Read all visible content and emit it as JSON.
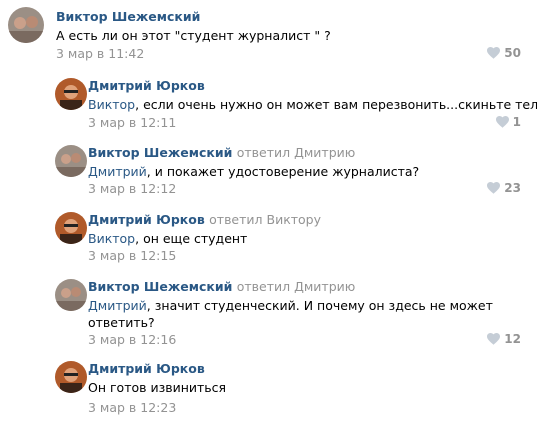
{
  "comments": [
    {
      "author": "Виктор Шежемский",
      "reply_to": "",
      "mention": "",
      "text": "А есть ли он этот \"студент журналист \" ?",
      "text2": "",
      "date": "3 мар в 11:42",
      "likes": "50",
      "avatar": "viktor"
    },
    {
      "author": "Дмитрий Юрков",
      "reply_to": "",
      "mention": "Виктор",
      "text": ", если очень нужно он может вам перезвонить...скиньте тел",
      "text2": "",
      "date": "3 мар в 12:11",
      "likes": "1",
      "avatar": "dmitry"
    },
    {
      "author": "Виктор Шежемский",
      "reply_to": "ответил Дмитрию",
      "mention": "Дмитрий",
      "text": ", и покажет удостоверение журналиста?",
      "text2": "",
      "date": "3 мар в 12:12",
      "likes": "23",
      "avatar": "viktor"
    },
    {
      "author": "Дмитрий Юрков",
      "reply_to": "ответил Виктору",
      "mention": "Виктор",
      "text": ", он еще студент",
      "text2": "",
      "date": "3 мар в 12:15",
      "likes": "",
      "avatar": "dmitry"
    },
    {
      "author": "Виктор Шежемский",
      "reply_to": "ответил Дмитрию",
      "mention": "Дмитрий",
      "text": ", значит студенческий. И почему он здесь не может",
      "text2": "ответить?",
      "date": "3 мар в 12:16",
      "likes": "12",
      "avatar": "viktor"
    },
    {
      "author": "Дмитрий Юрков",
      "reply_to": "",
      "mention": "",
      "text": "Он готов извиниться",
      "text2": "",
      "date": "3 мар в 12:23",
      "likes": "",
      "avatar": "dmitry"
    }
  ],
  "colors": {
    "link": "#2a5885",
    "meta": "#939393",
    "heart": "#c5cdd6"
  },
  "icons": {
    "like": "heart-icon"
  }
}
